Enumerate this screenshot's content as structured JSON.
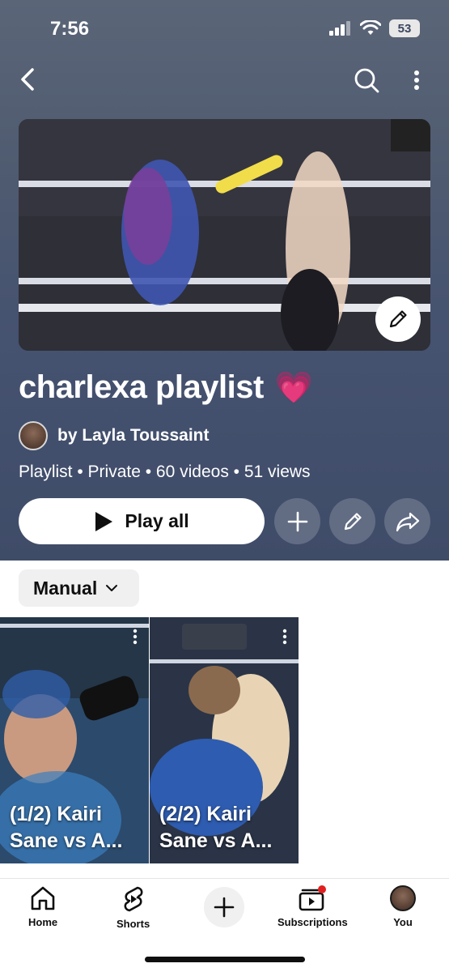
{
  "status_bar": {
    "time": "7:56",
    "battery": "53"
  },
  "playlist": {
    "title": "charlexa playlist",
    "heart": "💗",
    "owner": "by Layla Toussaint",
    "meta": "Playlist • Private • 60 videos • 51 views"
  },
  "actions": {
    "play_all": "Play all"
  },
  "sort": {
    "label": "Manual"
  },
  "videos": [
    {
      "title": "(1/2) Kairi Sane vs A..."
    },
    {
      "title": "(2/2) Kairi Sane vs A..."
    }
  ],
  "bottom_nav": {
    "home": "Home",
    "shorts": "Shorts",
    "subscriptions": "Subscriptions",
    "you": "You"
  },
  "colors": {
    "header_bg": "#4f5b70",
    "heart": "#ff4fb3",
    "notification_dot": "#e02020"
  }
}
